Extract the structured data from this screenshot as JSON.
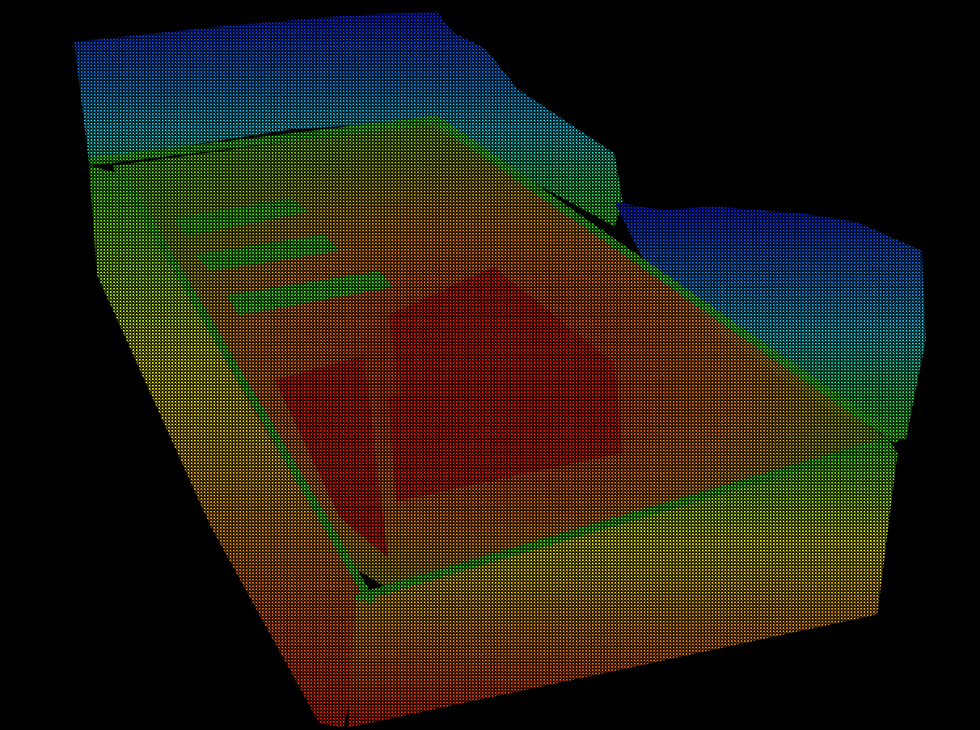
{
  "scene": {
    "kind": "point-cloud",
    "subject": "building-interior-scan",
    "colormap": "height-ramp",
    "background": "#000000"
  },
  "colors": {
    "low": "#ff1a00",
    "orange": "#ff8a00",
    "yellow": "#ffff00",
    "green": "#33ff00",
    "cyan": "#00e0ff",
    "high": "#0a1cff"
  }
}
